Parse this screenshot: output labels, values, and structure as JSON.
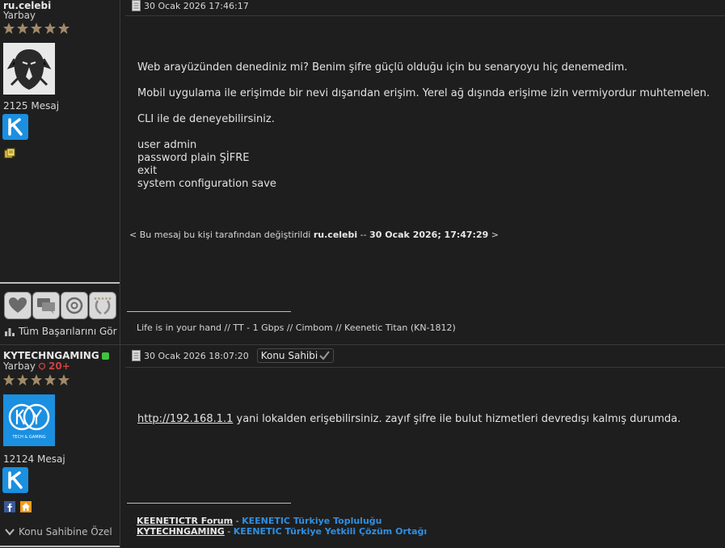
{
  "post1": {
    "username": "ru.celebi",
    "rank": "Yarbay",
    "message_count": "2125 Mesaj",
    "date": "30 Ocak 2026 17:46:17",
    "body_lines": [
      "Web arayüzünden denediniz mi? Benim şifre güçlü olduğu için bu senaryoyu hiç denemedim.",
      "Mobil uygulama ile erişimde bir nevi dışarıdan erişim. Yerel ağ dışında erişime izin vermiyordur muhtemelen.",
      "CLI ile de deneyebilirsiniz."
    ],
    "cli_lines": [
      "user admin",
      "password plain ŞİFRE",
      "exit",
      "system configuration save"
    ],
    "edited_prefix": "< Bu mesaj bu kişi tarafından değiştirildi",
    "edited_user": "ru.celebi",
    "edited_sep": "--",
    "edited_date": "30 Ocak 2026; 17:47:29",
    "edited_suffix": ">",
    "signature": "Life is in your hand // TT - 1 Gbps // Cimbom // Keenetic Titan (KN-1812)",
    "achievements_link": "Tüm Başarılarını Gör"
  },
  "post2": {
    "username": "KYTECHNGAMING",
    "rank": "Yarbay",
    "rank_extra": "20+",
    "message_count": "12124 Mesaj",
    "date": "30 Ocak 2026 18:07:20",
    "owner_badge": "Konu Sahibi",
    "body_link": "http://192.168.1.1",
    "body_rest": " yani lokalden erişebilirsiniz. zayıf şifre ile bulut hizmetleri devredışı kalmış durumda.",
    "sig1_name": "KEENETICTR Forum",
    "sig1_sep": " - ",
    "sig1_desc": "KEENETIC Türkiye Topluluğu",
    "sig2_name": "KYTECHNGAMING",
    "sig2_sep": " - ",
    "sig2_desc": "KEENETIC Türkiye Yetkili Çözüm Ortağı",
    "owner_special": "Konu Sahibine Özel",
    "avatar_text": "TECH & GAMING"
  },
  "colors": {
    "background": "#1e1e1e",
    "star": "#a08a6a",
    "online": "#3ec43e",
    "link_blue": "#2f8fe0",
    "badge_blue": "#1b8fe0",
    "rank_extra": "#d04040"
  }
}
